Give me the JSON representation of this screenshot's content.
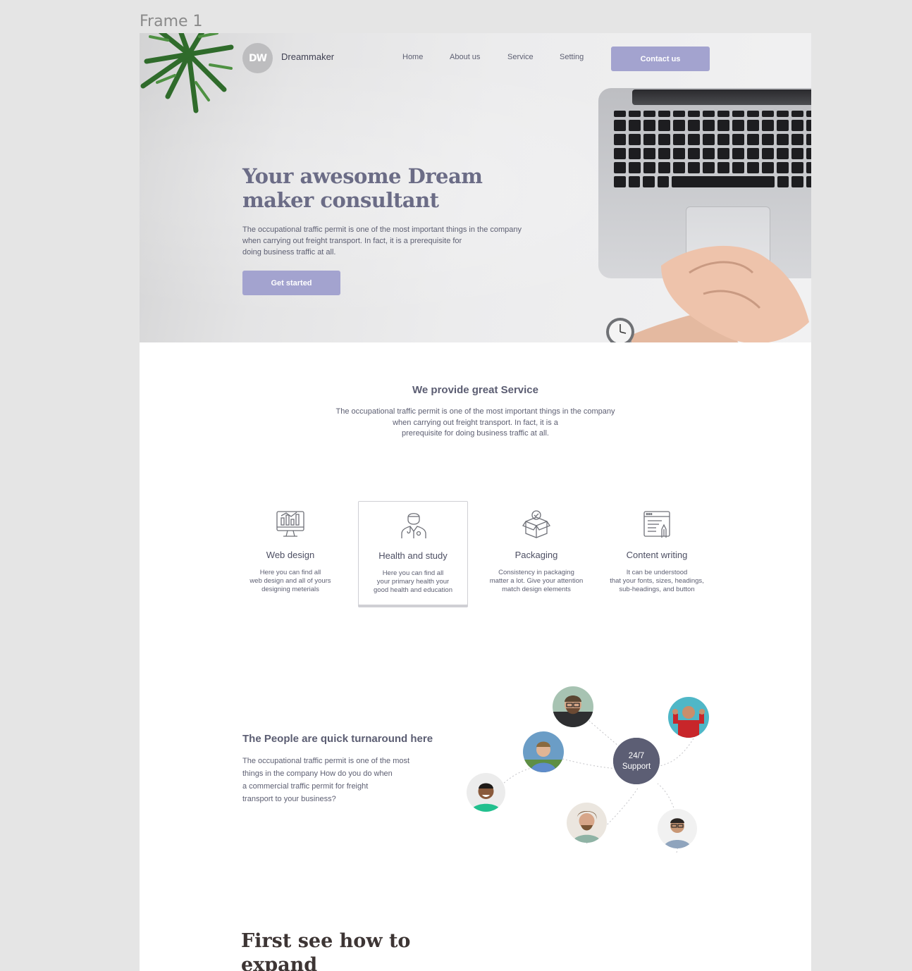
{
  "frame_label": "Frame 1",
  "header": {
    "logo_text": "DW",
    "brand": "Dreammaker",
    "nav": [
      "Home",
      "About us",
      "Service",
      "Setting"
    ],
    "contact_label": "Contact us"
  },
  "hero": {
    "title": "Your awesome Dream maker consultant",
    "text": "The occupational traffic permit is one of the most important things in the company\nwhen carrying out freight transport.  In fact, it is a prerequisite for\ndoing business traffic at all.",
    "cta": "Get started"
  },
  "services": {
    "title": "We provide great Service",
    "text": "The occupational traffic permit is one of the most important things in the company\nwhen carrying out freight transport.  In fact, it is a\nprerequisite for doing business traffic at all.",
    "cards": [
      {
        "title": "Web design",
        "text": "Here you can find all\nweb design and all of yours\ndesigning meterials",
        "icon": "monitor-chart-icon"
      },
      {
        "title": "Health and study",
        "text": "Here you can find all\nyour primary health your\ngood health and education",
        "icon": "doctor-icon"
      },
      {
        "title": "Packaging",
        "text": "Consistency in packaging\nmatter a lot. Give your attention\nmatch design elements",
        "icon": "box-check-icon"
      },
      {
        "title": "Content writing",
        "text": "It can be understood\nthat your fonts, sizes, headings,\nsub-headings, and button",
        "icon": "document-pen-icon"
      }
    ]
  },
  "people": {
    "title": "The People are quick turnaround here",
    "text": "The occupational traffic permit is one of the most\nthings in the company How do you do when\na commercial traffic permit for freight\ntransport to your business?",
    "support": "24/7\nSupport"
  },
  "demo": {
    "title": "First see how to expand\nor our demo"
  },
  "colors": {
    "accent": "#a3a3cf",
    "text": "#5b5d72",
    "support_bg": "#5c5e74"
  }
}
